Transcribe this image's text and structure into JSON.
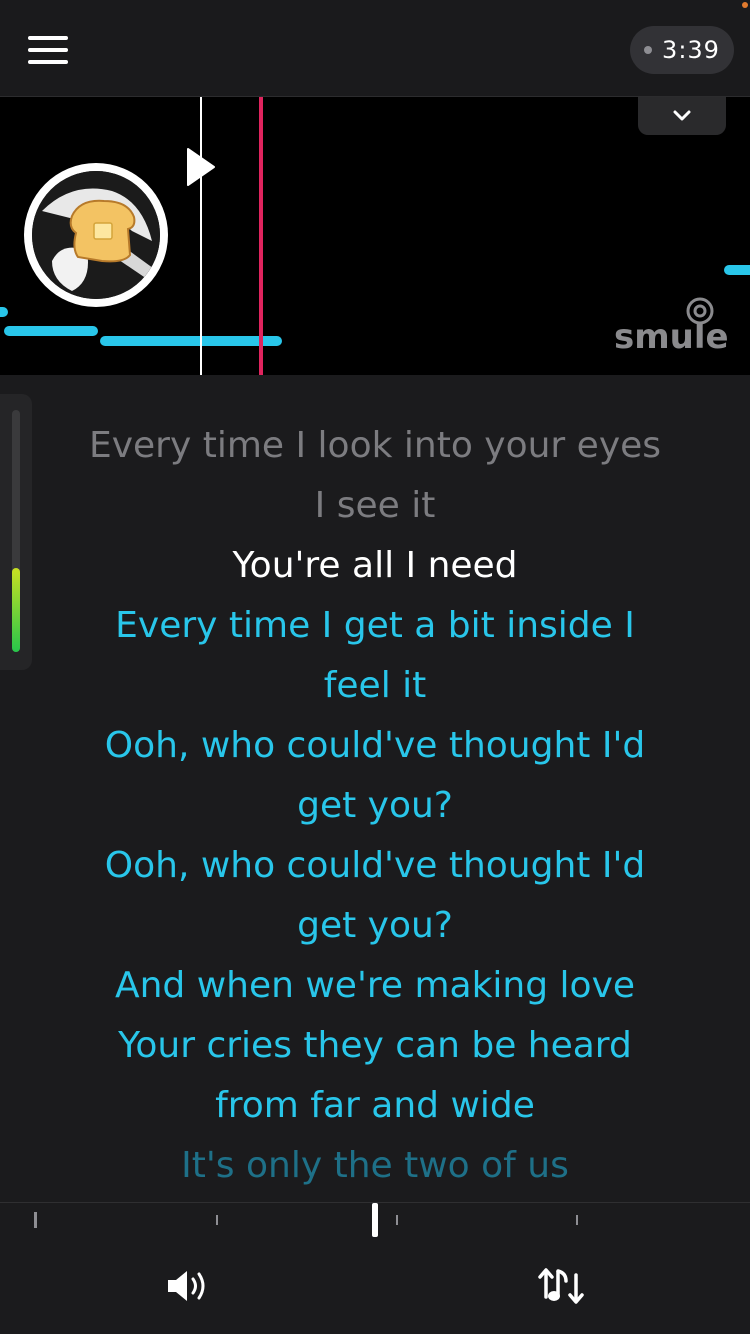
{
  "header": {
    "timer": "3:39",
    "menu_icon": "hamburger-menu-icon",
    "accent_dot_color": "#e07a2e"
  },
  "stage": {
    "logo_text": "smule",
    "note_color": "#29c6ea",
    "pitch_line_color": "#e0245e",
    "collapse_icon": "chevron-down-icon",
    "play_icon": "play-icon"
  },
  "lyrics": [
    {
      "text": "Every time I look into your eyes",
      "state": "past"
    },
    {
      "text": "I see it",
      "state": "past"
    },
    {
      "text": "You're all I need",
      "state": "current"
    },
    {
      "text": "Every time I get a bit inside I",
      "state": "upcoming"
    },
    {
      "text": "feel it",
      "state": "upcoming"
    },
    {
      "text": "Ooh, who could've thought I'd",
      "state": "upcoming"
    },
    {
      "text": "get you?",
      "state": "upcoming"
    },
    {
      "text": "Ooh, who could've thought I'd",
      "state": "upcoming"
    },
    {
      "text": "get you?",
      "state": "upcoming"
    },
    {
      "text": "And when we're making love",
      "state": "upcoming"
    },
    {
      "text": "Your cries they can be heard",
      "state": "upcoming"
    },
    {
      "text": "from far and wide",
      "state": "upcoming"
    },
    {
      "text": "It's only the two of us",
      "state": "faded"
    }
  ],
  "bottombar": {
    "volume_icon": "volume-icon",
    "pitch_icon": "key-change-icon"
  }
}
